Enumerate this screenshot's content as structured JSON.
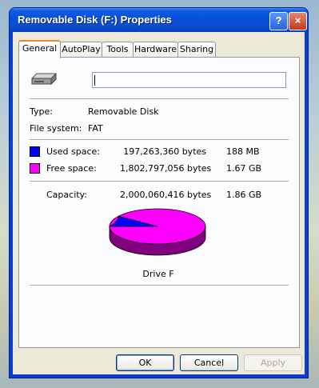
{
  "window": {
    "title": "Removable Disk (F:) Properties",
    "help_label": "?",
    "close_label": "×"
  },
  "tabs": [
    {
      "label": "General"
    },
    {
      "label": "AutoPlay"
    },
    {
      "label": "Tools"
    },
    {
      "label": "Hardware"
    },
    {
      "label": "Sharing"
    }
  ],
  "general": {
    "name_value": "",
    "type_label": "Type:",
    "type_value": "Removable Disk",
    "fs_label": "File system:",
    "fs_value": "FAT",
    "used_label": "Used space:",
    "used_bytes": "197,263,360 bytes",
    "used_size": "188 MB",
    "free_label": "Free space:",
    "free_bytes": "1,802,797,056 bytes",
    "free_size": "1.67 GB",
    "capacity_label": "Capacity:",
    "capacity_bytes": "2,000,060,416 bytes",
    "capacity_size": "1.86 GB",
    "drive_label": "Drive F",
    "used_fraction": 0.0986,
    "used_color": "#0000ff",
    "free_color": "#ff00ff"
  },
  "buttons": {
    "ok": "OK",
    "cancel": "Cancel",
    "apply": "Apply"
  },
  "icons": {
    "drive": "removable-drive-icon"
  }
}
